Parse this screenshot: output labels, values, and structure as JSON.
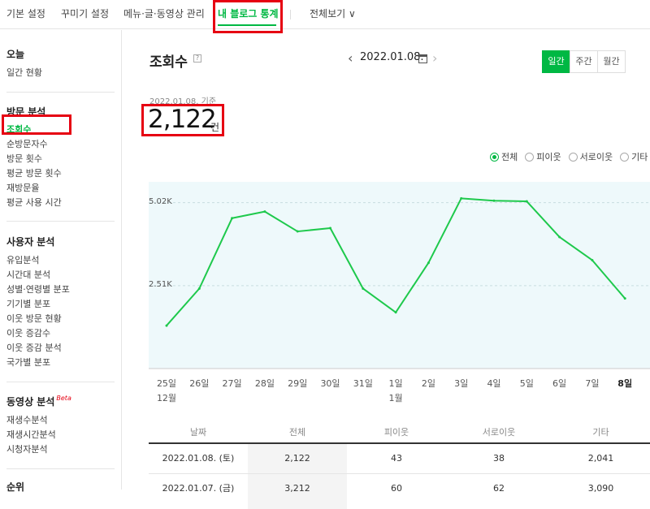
{
  "topnav": {
    "tabs": [
      {
        "label": "기본 설정"
      },
      {
        "label": "꾸미기 설정"
      },
      {
        "label": "메뉴·글·동영상 관리"
      },
      {
        "label": "내 블로그 통계"
      },
      {
        "label": "전체보기 ∨"
      }
    ],
    "active_tab": "내 블로그 통계",
    "accent_color": "#00b843"
  },
  "sidebar": {
    "sections": [
      {
        "title": "오늘",
        "items": [
          "일간 현황"
        ]
      },
      {
        "title": "방문 분석",
        "items": [
          "조회수",
          "순방문자수",
          "방문 횟수",
          "평균 방문 횟수",
          "재방문율",
          "평균 사용 시간"
        ]
      },
      {
        "title": "사용자 분석",
        "items": [
          "유입분석",
          "시간대 분석",
          "성별·연령별 분포",
          "기기별 분포",
          "이웃 방문 현황",
          "이웃 증감수",
          "이웃 증감 분석",
          "국가별 분포"
        ]
      },
      {
        "title": "동영상 분석",
        "badge": "Beta",
        "items": [
          "재생수분석",
          "재생시간분석",
          "시청자분석"
        ]
      },
      {
        "title": "순위",
        "items": []
      }
    ],
    "active_item": "조회수"
  },
  "main": {
    "title": "조회수",
    "help_glyph": "?",
    "date": "2022.01.08.",
    "prev_glyph": "‹",
    "next_glyph": "›",
    "periods": [
      "일간",
      "주간",
      "월간"
    ],
    "active_period": "일간",
    "basis_text": "2022.01.08. 기준",
    "total_value": "2,122",
    "total_unit": "건",
    "legend": [
      {
        "label": "전체",
        "selected": true
      },
      {
        "label": "피이웃",
        "selected": false
      },
      {
        "label": "서로이웃",
        "selected": false
      },
      {
        "label": "기타",
        "selected": false
      }
    ]
  },
  "chart_data": {
    "type": "line",
    "categories": [
      "25일",
      "26일",
      "27일",
      "28일",
      "29일",
      "30일",
      "31일",
      "1일",
      "2일",
      "3일",
      "4일",
      "5일",
      "6일",
      "7일",
      "8일"
    ],
    "month_labels": [
      {
        "index": 0,
        "label": "12월"
      },
      {
        "index": 7,
        "label": "1월"
      }
    ],
    "highlight_category": "8일",
    "series": [
      {
        "color": "#1ec94c",
        "values": [
          1300,
          2420,
          4550,
          4750,
          4150,
          4250,
          2420,
          1700,
          3200,
          5150,
          5080,
          5060,
          3980,
          3280,
          2122
        ]
      }
    ],
    "yticks": [
      {
        "value": 2510,
        "label": "2.51K"
      },
      {
        "value": 5020,
        "label": "5.02K"
      }
    ],
    "ylim": [
      0,
      5650
    ],
    "grid": true,
    "fill_color": "#eef9fb",
    "legend_position": "top-right"
  },
  "table": {
    "headers": [
      "날짜",
      "전체",
      "피이웃",
      "서로이웃",
      "기타"
    ],
    "rows": [
      [
        "2022.01.08. (토)",
        "2,122",
        "43",
        "38",
        "2,041"
      ],
      [
        "2022.01.07. (금)",
        "3,212",
        "60",
        "62",
        "3,090"
      ]
    ]
  }
}
